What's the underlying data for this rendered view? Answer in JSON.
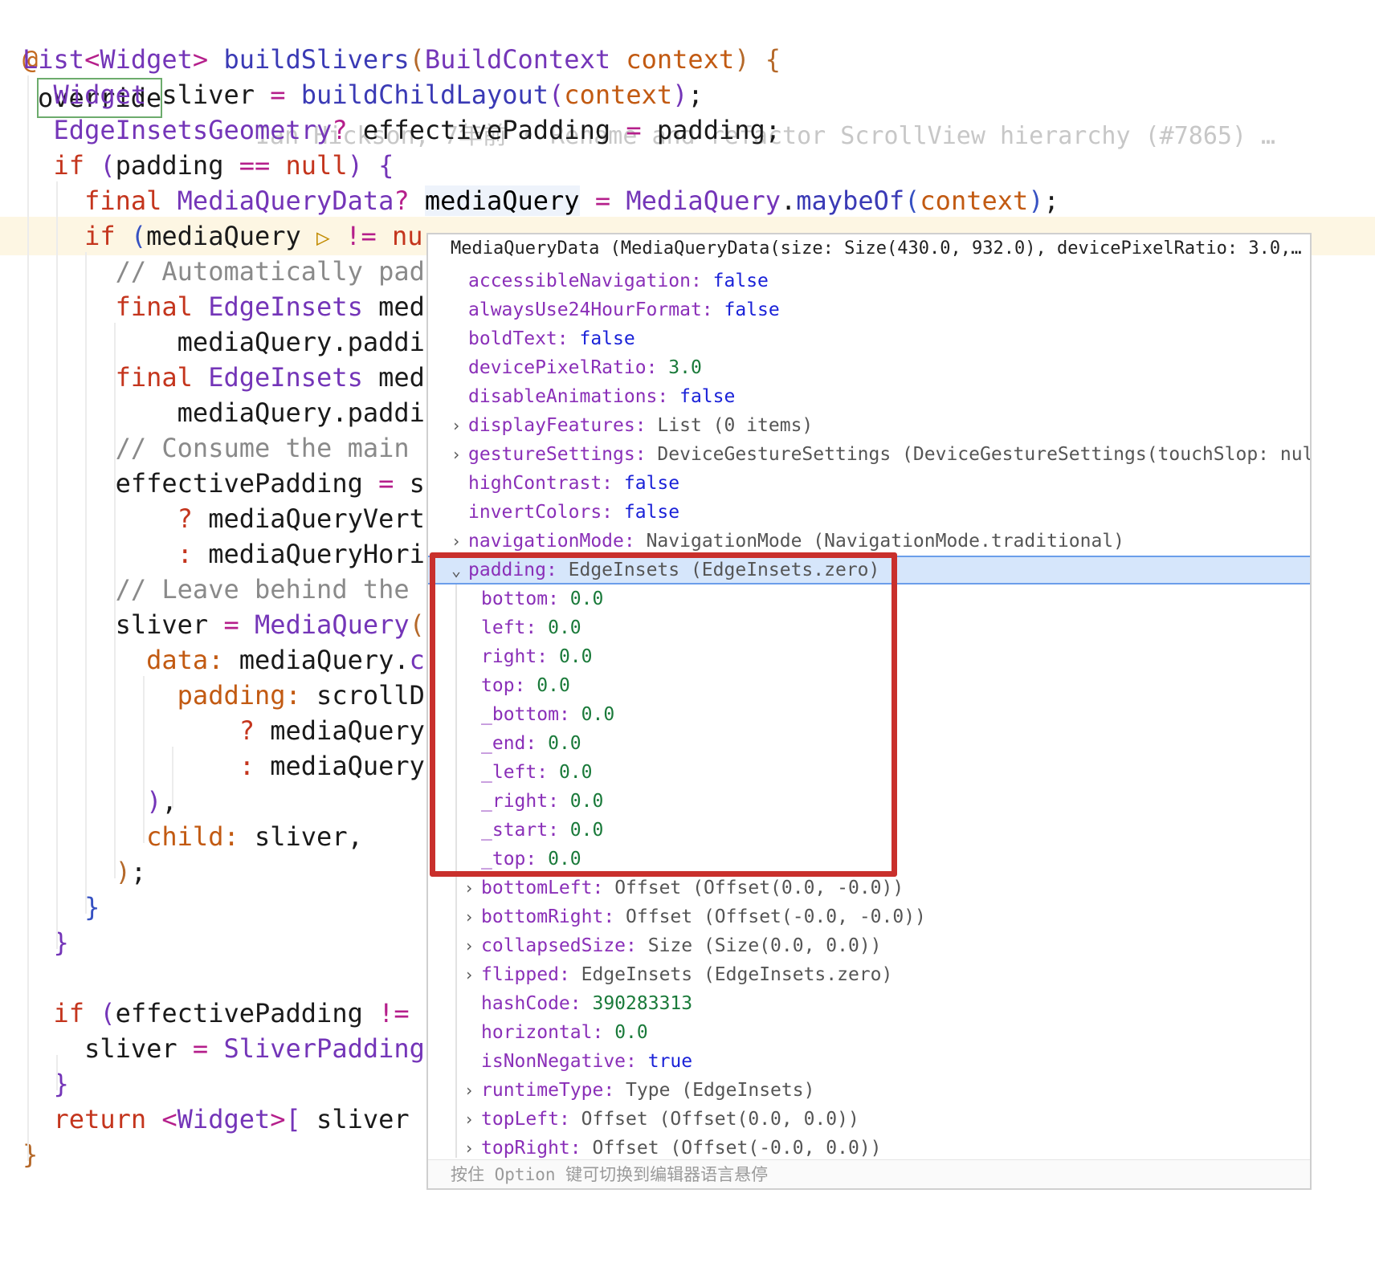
{
  "editor": {
    "annotation": "@",
    "override_kw": "override",
    "blame": "Ian Hickson, 7年前 • Rename and refactor ScrollView hierarchy (#7865) …",
    "lines": [
      {
        "segments": [
          {
            "c": "ty",
            "t": "List"
          },
          {
            "c": "op",
            "t": "<"
          },
          {
            "c": "ty",
            "t": "Widget"
          },
          {
            "c": "op",
            "t": ">"
          },
          {
            "c": "plain",
            "t": " "
          },
          {
            "c": "fn",
            "t": "buildSlivers"
          },
          {
            "c": "brk1",
            "t": "("
          },
          {
            "c": "ty",
            "t": "BuildContext"
          },
          {
            "c": "plain",
            "t": " "
          },
          {
            "c": "par",
            "t": "context"
          },
          {
            "c": "brk1",
            "t": ")"
          },
          {
            "c": "plain",
            "t": " "
          },
          {
            "c": "brk1",
            "t": "{"
          }
        ]
      },
      {
        "segments": [
          {
            "c": "plain",
            "t": "  "
          },
          {
            "c": "ty",
            "t": "Widget"
          },
          {
            "c": "plain",
            "t": " sliver "
          },
          {
            "c": "op",
            "t": "="
          },
          {
            "c": "plain",
            "t": " "
          },
          {
            "c": "fn",
            "t": "buildChildLayout"
          },
          {
            "c": "ty",
            "t": "("
          },
          {
            "c": "par",
            "t": "context"
          },
          {
            "c": "ty",
            "t": ")"
          },
          {
            "c": "plain",
            "t": ";"
          }
        ]
      },
      {
        "segments": [
          {
            "c": "plain",
            "t": "  "
          },
          {
            "c": "ty",
            "t": "EdgeInsetsGeometry"
          },
          {
            "c": "op",
            "t": "?"
          },
          {
            "c": "plain",
            "t": " effectivePadding "
          },
          {
            "c": "op",
            "t": "="
          },
          {
            "c": "plain",
            "t": " padding;"
          }
        ]
      },
      {
        "segments": [
          {
            "c": "plain",
            "t": "  "
          },
          {
            "c": "kw",
            "t": "if"
          },
          {
            "c": "plain",
            "t": " "
          },
          {
            "c": "ty",
            "t": "("
          },
          {
            "c": "plain",
            "t": "padding "
          },
          {
            "c": "op",
            "t": "=="
          },
          {
            "c": "plain",
            "t": " "
          },
          {
            "c": "kw",
            "t": "null"
          },
          {
            "c": "ty",
            "t": ")"
          },
          {
            "c": "plain",
            "t": " "
          },
          {
            "c": "ty",
            "t": "{"
          }
        ]
      },
      {
        "segments": [
          {
            "c": "plain",
            "t": "    "
          },
          {
            "c": "kw",
            "t": "final"
          },
          {
            "c": "plain",
            "t": " "
          },
          {
            "c": "ty",
            "t": "MediaQueryData"
          },
          {
            "c": "op",
            "t": "?"
          },
          {
            "c": "plain",
            "t": " "
          },
          {
            "c": "mq-hl",
            "t": "mediaQuery"
          },
          {
            "c": "plain",
            "t": " "
          },
          {
            "c": "op",
            "t": "="
          },
          {
            "c": "plain",
            "t": " "
          },
          {
            "c": "ty",
            "t": "MediaQuery"
          },
          {
            "c": "plain",
            "t": "."
          },
          {
            "c": "fn",
            "t": "maybeOf"
          },
          {
            "c": "brk2",
            "t": "("
          },
          {
            "c": "par",
            "t": "context"
          },
          {
            "c": "brk2",
            "t": ")"
          },
          {
            "c": "plain",
            "t": ";"
          }
        ]
      },
      {
        "highlight": true,
        "segments": [
          {
            "c": "plain",
            "t": "    "
          },
          {
            "c": "kw",
            "t": "if"
          },
          {
            "c": "plain",
            "t": " "
          },
          {
            "c": "brk2",
            "t": "("
          },
          {
            "c": "plain",
            "t": "mediaQuery "
          },
          {
            "c": "dbg-icon",
            "t": "▷"
          },
          {
            "c": "plain",
            "t": " "
          },
          {
            "c": "op",
            "t": "!="
          },
          {
            "c": "plain",
            "t": " "
          },
          {
            "c": "kw",
            "t": "nu"
          }
        ]
      },
      {
        "segments": [
          {
            "c": "plain",
            "t": "      "
          },
          {
            "c": "cm",
            "t": "// Automatically pad"
          }
        ]
      },
      {
        "segments": [
          {
            "c": "plain",
            "t": "      "
          },
          {
            "c": "kw",
            "t": "final"
          },
          {
            "c": "plain",
            "t": " "
          },
          {
            "c": "ty",
            "t": "EdgeInsets"
          },
          {
            "c": "plain",
            "t": " med"
          }
        ]
      },
      {
        "segments": [
          {
            "c": "plain",
            "t": "          mediaQuery.paddi"
          }
        ]
      },
      {
        "segments": [
          {
            "c": "plain",
            "t": "      "
          },
          {
            "c": "kw",
            "t": "final"
          },
          {
            "c": "plain",
            "t": " "
          },
          {
            "c": "ty",
            "t": "EdgeInsets"
          },
          {
            "c": "plain",
            "t": " med"
          }
        ]
      },
      {
        "segments": [
          {
            "c": "plain",
            "t": "          mediaQuery.paddi"
          }
        ]
      },
      {
        "segments": [
          {
            "c": "plain",
            "t": "      "
          },
          {
            "c": "cm",
            "t": "// Consume the main"
          }
        ]
      },
      {
        "segments": [
          {
            "c": "plain",
            "t": "      effectivePadding "
          },
          {
            "c": "op",
            "t": "="
          },
          {
            "c": "plain",
            "t": " s"
          }
        ]
      },
      {
        "segments": [
          {
            "c": "plain",
            "t": "          "
          },
          {
            "c": "kw",
            "t": "?"
          },
          {
            "c": "plain",
            "t": " mediaQueryVert"
          }
        ]
      },
      {
        "segments": [
          {
            "c": "plain",
            "t": "          "
          },
          {
            "c": "kw",
            "t": ":"
          },
          {
            "c": "plain",
            "t": " mediaQueryHori"
          }
        ]
      },
      {
        "segments": [
          {
            "c": "plain",
            "t": "      "
          },
          {
            "c": "cm",
            "t": "// Leave behind the"
          }
        ]
      },
      {
        "segments": [
          {
            "c": "plain",
            "t": "      sliver "
          },
          {
            "c": "op",
            "t": "="
          },
          {
            "c": "plain",
            "t": " "
          },
          {
            "c": "ty",
            "t": "MediaQuery"
          },
          {
            "c": "brk1",
            "t": "("
          }
        ]
      },
      {
        "segments": [
          {
            "c": "plain",
            "t": "        "
          },
          {
            "c": "par",
            "t": "data:"
          },
          {
            "c": "plain",
            "t": " mediaQuery."
          },
          {
            "c": "ty",
            "t": "c"
          }
        ]
      },
      {
        "segments": [
          {
            "c": "plain",
            "t": "          "
          },
          {
            "c": "par",
            "t": "padding:"
          },
          {
            "c": "plain",
            "t": " scrollD"
          }
        ]
      },
      {
        "segments": [
          {
            "c": "plain",
            "t": "              "
          },
          {
            "c": "kw",
            "t": "?"
          },
          {
            "c": "plain",
            "t": " mediaQuery"
          }
        ]
      },
      {
        "segments": [
          {
            "c": "plain",
            "t": "              "
          },
          {
            "c": "kw",
            "t": ":"
          },
          {
            "c": "plain",
            "t": " mediaQuery"
          }
        ]
      },
      {
        "segments": [
          {
            "c": "plain",
            "t": "        "
          },
          {
            "c": "ty",
            "t": ")"
          },
          {
            "c": "plain",
            "t": ","
          }
        ]
      },
      {
        "segments": [
          {
            "c": "plain",
            "t": "        "
          },
          {
            "c": "par",
            "t": "child:"
          },
          {
            "c": "plain",
            "t": " sliver,"
          }
        ]
      },
      {
        "segments": [
          {
            "c": "plain",
            "t": "      "
          },
          {
            "c": "brk1",
            "t": ")"
          },
          {
            "c": "plain",
            "t": ";"
          }
        ]
      },
      {
        "segments": [
          {
            "c": "plain",
            "t": "    "
          },
          {
            "c": "brk2",
            "t": "}"
          }
        ]
      },
      {
        "segments": [
          {
            "c": "plain",
            "t": "  "
          },
          {
            "c": "ty",
            "t": "}"
          }
        ]
      },
      {
        "segments": []
      },
      {
        "segments": [
          {
            "c": "plain",
            "t": "  "
          },
          {
            "c": "kw",
            "t": "if"
          },
          {
            "c": "plain",
            "t": " "
          },
          {
            "c": "ty",
            "t": "("
          },
          {
            "c": "plain",
            "t": "effectivePadding "
          },
          {
            "c": "op",
            "t": "!="
          }
        ]
      },
      {
        "segments": [
          {
            "c": "plain",
            "t": "    sliver "
          },
          {
            "c": "op",
            "t": "="
          },
          {
            "c": "plain",
            "t": " "
          },
          {
            "c": "ty",
            "t": "SliverPadding"
          }
        ]
      },
      {
        "segments": [
          {
            "c": "plain",
            "t": "  "
          },
          {
            "c": "ty",
            "t": "}"
          }
        ]
      },
      {
        "segments": [
          {
            "c": "plain",
            "t": "  "
          },
          {
            "c": "kw",
            "t": "return"
          },
          {
            "c": "plain",
            "t": " "
          },
          {
            "c": "op",
            "t": "<"
          },
          {
            "c": "ty",
            "t": "Widget"
          },
          {
            "c": "op",
            "t": ">"
          },
          {
            "c": "ty",
            "t": "["
          },
          {
            "c": "plain",
            "t": " sliver "
          },
          {
            "c": "ty",
            "t": "]"
          },
          {
            "c": "plain",
            "t": ";"
          }
        ]
      },
      {
        "segments": [
          {
            "c": "brk1",
            "t": "}"
          }
        ]
      }
    ]
  },
  "popup": {
    "header": "MediaQueryData (MediaQueryData(size: Size(430.0, 932.0), devicePixelRatio: 3.0,…",
    "rows": [
      {
        "depth": 0,
        "chevron": "",
        "key": "accessibleNavigation",
        "type": "",
        "value": "false",
        "vclass": "vb"
      },
      {
        "depth": 0,
        "chevron": "",
        "key": "alwaysUse24HourFormat",
        "type": "",
        "value": "false",
        "vclass": "vb"
      },
      {
        "depth": 0,
        "chevron": "",
        "key": "boldText",
        "type": "",
        "value": "false",
        "vclass": "vb"
      },
      {
        "depth": 0,
        "chevron": "",
        "key": "devicePixelRatio",
        "type": "",
        "value": "3.0",
        "vclass": "vn"
      },
      {
        "depth": 0,
        "chevron": "",
        "key": "disableAnimations",
        "type": "",
        "value": "false",
        "vclass": "vb"
      },
      {
        "depth": 0,
        "chevron": "›",
        "key": "displayFeatures",
        "type": "List (0 items)",
        "value": "",
        "vclass": "t"
      },
      {
        "depth": 0,
        "chevron": "›",
        "key": "gestureSettings",
        "type": "DeviceGestureSettings (DeviceGestureSettings(touchSlop: null))",
        "value": "",
        "vclass": "t"
      },
      {
        "depth": 0,
        "chevron": "",
        "key": "highContrast",
        "type": "",
        "value": "false",
        "vclass": "vb"
      },
      {
        "depth": 0,
        "chevron": "",
        "key": "invertColors",
        "type": "",
        "value": "false",
        "vclass": "vb"
      },
      {
        "depth": 0,
        "chevron": "›",
        "key": "navigationMode",
        "type": "NavigationMode (NavigationMode.traditional)",
        "value": "",
        "vclass": "t"
      },
      {
        "depth": 0,
        "chevron": "⌄",
        "key": "padding",
        "type": "EdgeInsets (EdgeInsets.zero)",
        "value": "",
        "vclass": "t",
        "selected": true
      },
      {
        "depth": 1,
        "chevron": "",
        "key": "bottom",
        "type": "",
        "value": "0.0",
        "vclass": "vn"
      },
      {
        "depth": 1,
        "chevron": "",
        "key": "left",
        "type": "",
        "value": "0.0",
        "vclass": "vn"
      },
      {
        "depth": 1,
        "chevron": "",
        "key": "right",
        "type": "",
        "value": "0.0",
        "vclass": "vn"
      },
      {
        "depth": 1,
        "chevron": "",
        "key": "top",
        "type": "",
        "value": "0.0",
        "vclass": "vn"
      },
      {
        "depth": 1,
        "chevron": "",
        "key": "_bottom",
        "type": "",
        "value": "0.0",
        "vclass": "vn"
      },
      {
        "depth": 1,
        "chevron": "",
        "key": "_end",
        "type": "",
        "value": "0.0",
        "vclass": "vn"
      },
      {
        "depth": 1,
        "chevron": "",
        "key": "_left",
        "type": "",
        "value": "0.0",
        "vclass": "vn"
      },
      {
        "depth": 1,
        "chevron": "",
        "key": "_right",
        "type": "",
        "value": "0.0",
        "vclass": "vn"
      },
      {
        "depth": 1,
        "chevron": "",
        "key": "_start",
        "type": "",
        "value": "0.0",
        "vclass": "vn"
      },
      {
        "depth": 1,
        "chevron": "",
        "key": "_top",
        "type": "",
        "value": "0.0",
        "vclass": "vn"
      },
      {
        "depth": 1,
        "chevron": "›",
        "key": "bottomLeft",
        "type": "Offset (Offset(0.0, -0.0))",
        "value": "",
        "vclass": "t"
      },
      {
        "depth": 1,
        "chevron": "›",
        "key": "bottomRight",
        "type": "Offset (Offset(-0.0, -0.0))",
        "value": "",
        "vclass": "t"
      },
      {
        "depth": 1,
        "chevron": "›",
        "key": "collapsedSize",
        "type": "Size (Size(0.0, 0.0))",
        "value": "",
        "vclass": "t"
      },
      {
        "depth": 1,
        "chevron": "›",
        "key": "flipped",
        "type": "EdgeInsets (EdgeInsets.zero)",
        "value": "",
        "vclass": "t"
      },
      {
        "depth": 1,
        "chevron": "",
        "key": "hashCode",
        "type": "",
        "value": "390283313",
        "vclass": "vn"
      },
      {
        "depth": 1,
        "chevron": "",
        "key": "horizontal",
        "type": "",
        "value": "0.0",
        "vclass": "vn"
      },
      {
        "depth": 1,
        "chevron": "",
        "key": "isNonNegative",
        "type": "",
        "value": "true",
        "vclass": "vb"
      },
      {
        "depth": 1,
        "chevron": "›",
        "key": "runtimeType",
        "type": "Type (EdgeInsets)",
        "value": "",
        "vclass": "t"
      },
      {
        "depth": 1,
        "chevron": "›",
        "key": "topLeft",
        "type": "Offset (Offset(0.0, 0.0))",
        "value": "",
        "vclass": "t"
      },
      {
        "depth": 1,
        "chevron": "›",
        "key": "topRight",
        "type": "Offset (Offset(-0.0, 0.0))",
        "value": "",
        "vclass": "t"
      }
    ],
    "footer": "按住 Option 键可切换到编辑器语言悬停"
  },
  "colors": {
    "highlight_box": "#c9302c",
    "selection": "#d6e6fb",
    "current_line": "#fdf6e3"
  }
}
